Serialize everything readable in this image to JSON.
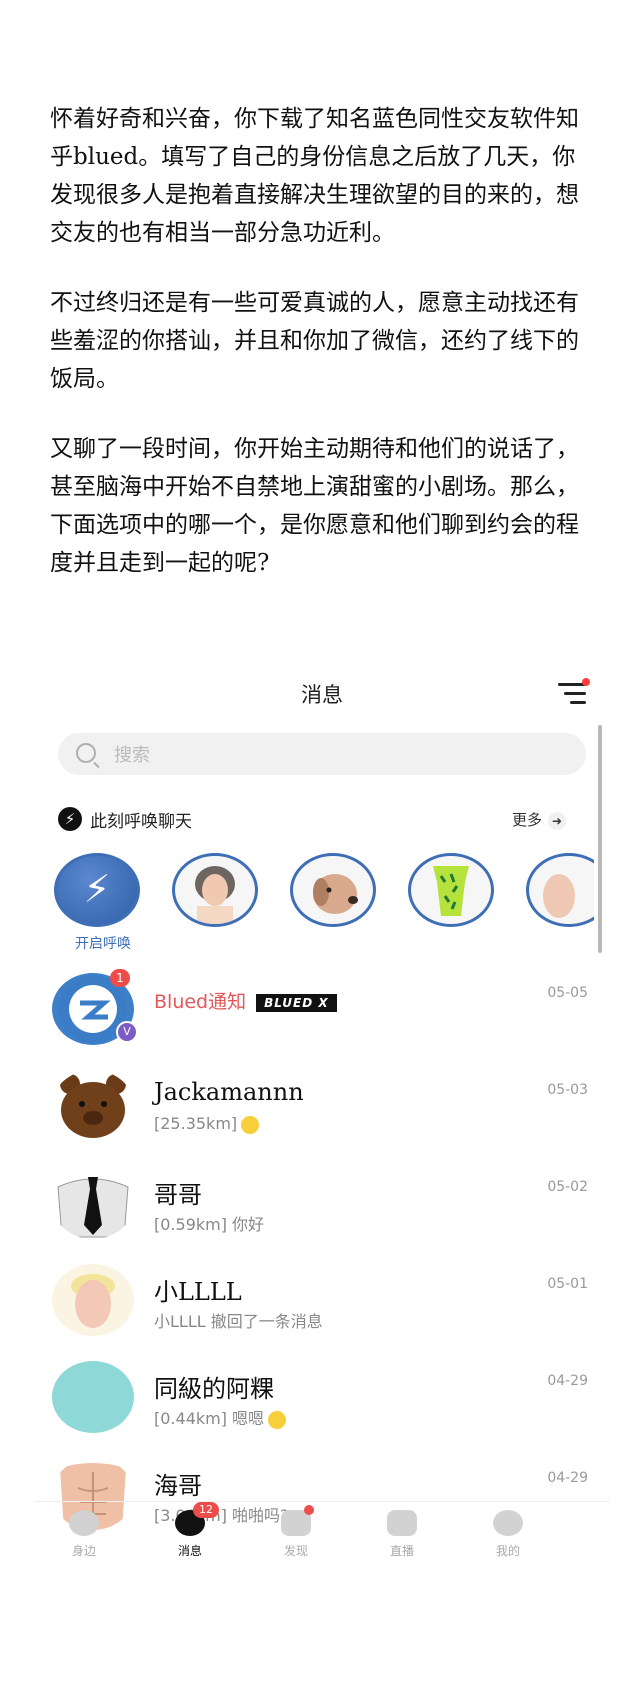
{
  "story": {
    "p1": "怀着好奇和兴奋，你下载了知名蓝色同性交友软件知乎blued。填写了自己的身份信息之后放了几天，你发现很多人是抱着直接解决生理欲望的目的来的，想交友的也有相当一部分急功近利。",
    "p2": "不过终归还是有一些可爱真诚的人，愿意主动找还有些羞涩的你搭讪，并且和你加了微信，还约了线下的饭局。",
    "p3": "又聊了一段时间，你开始主动期待和他们的说话了，甚至脑海中开始不自禁地上演甜蜜的小剧场。那么，下面选项中的哪一个，是你愿意和他们聊到约会的程度并且走到一起的呢?"
  },
  "header": {
    "title": "消息"
  },
  "search": {
    "placeholder": "搜索"
  },
  "call": {
    "label": "此刻呼唤聊天",
    "more": "更多",
    "summon_label": "开启呼唤"
  },
  "messages": [
    {
      "name": "Blued通知",
      "tag": "BLUED X",
      "badge": "1",
      "preview": "",
      "date": "05-05"
    },
    {
      "name": "Jackamannn",
      "preview": "[25.35km]",
      "date": "05-03"
    },
    {
      "name": "哥哥",
      "preview": "[0.59km] 你好",
      "date": "05-02"
    },
    {
      "name": "小LLLL",
      "preview": "小LLLL 撤回了一条消息",
      "date": "05-01"
    },
    {
      "name": "同級的阿粿",
      "preview": "[0.44km] 嗯嗯",
      "date": "04-29"
    },
    {
      "name": "海哥",
      "preview": "[3.08km] 啪啪吗?",
      "date": "04-29"
    }
  ],
  "tabs": [
    {
      "label": "身边"
    },
    {
      "label": "消息",
      "badge": "12"
    },
    {
      "label": "发现"
    },
    {
      "label": "直播"
    },
    {
      "label": "我的"
    }
  ],
  "colors": {
    "accent_blue": "#3e6fb6",
    "badge_red": "#ee4b4b",
    "notice_red": "#e25858"
  }
}
